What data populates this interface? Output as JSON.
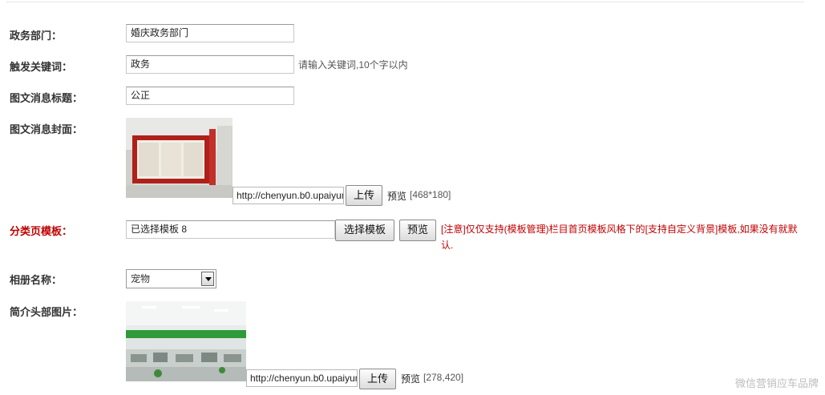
{
  "form": {
    "dept_label": "政务部门：",
    "dept_value": "婚庆政务部门",
    "keyword_label": "触发关键词：",
    "keyword_value": "政务",
    "keyword_hint": "请输入关键词,10个字以内",
    "title_label": "图文消息标题：",
    "title_value": "公正",
    "cover_label": "图文消息封面：",
    "cover_url": "http://chenyun.b0.upaiyun",
    "cover_upload": "上传",
    "cover_preview": "预览",
    "cover_size": "[468*180]",
    "template_label": "分类页模板：",
    "template_value": "已选择模板 8",
    "template_select_btn": "选择模板",
    "template_preview_btn": "预览",
    "template_notice": "[注意]仅仅支持(模板管理)栏目首页模板风格下的[支持自定义背景]模板,如果没有就默认.",
    "album_label": "相册名称：",
    "album_value": "宠物",
    "header_label": "简介头部图片：",
    "header_url": "http://chenyun.b0.upaiyun",
    "header_upload": "上传",
    "header_preview": "预览",
    "header_size": "[278,420]"
  },
  "watermark": "微信营销应车品牌",
  "colors": {
    "required_label": "#c00000",
    "notice": "#c00000"
  }
}
